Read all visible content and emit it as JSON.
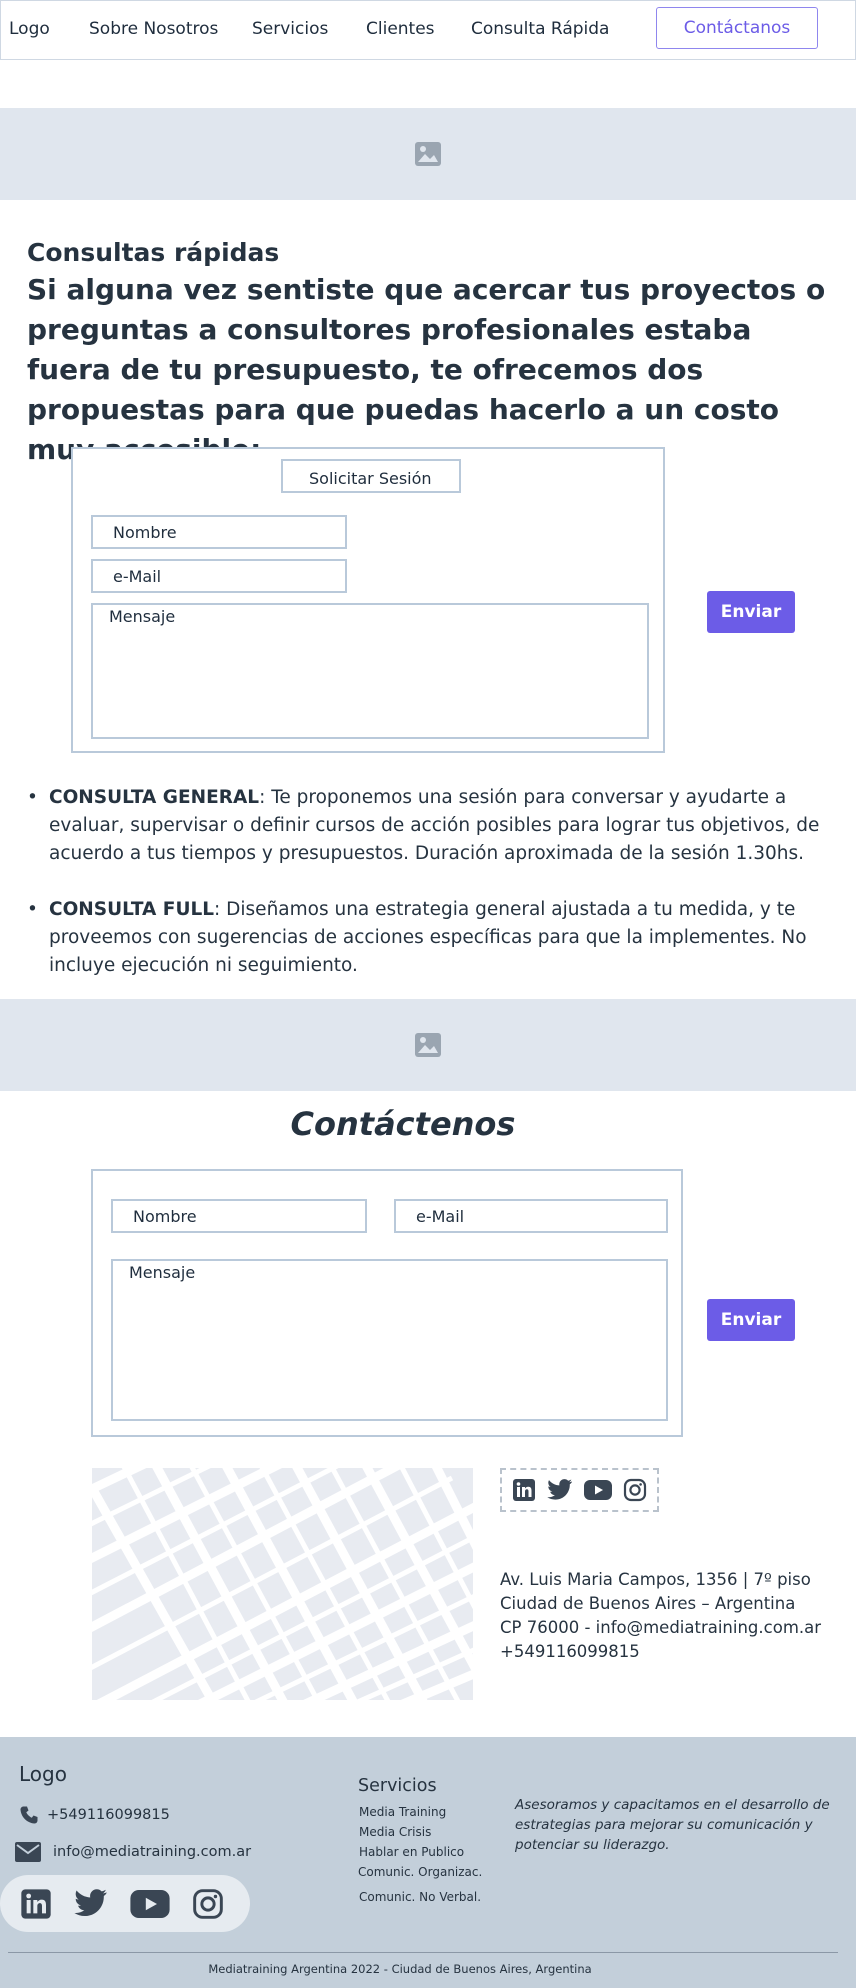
{
  "nav": {
    "logo": "Logo",
    "items": [
      "Sobre Nosotros",
      "Servicios",
      "Clientes",
      "Consulta Rápida"
    ],
    "cta": "Contáctanos"
  },
  "quick": {
    "title": "Consultas rápidas",
    "headline": "Si alguna vez sentiste que acercar tus proyectos o preguntas a consultores profesionales estaba fuera de tu presupuesto, te ofrecemos dos propuestas para que puedas hacerlo a un costo muy accesible:",
    "form": {
      "session_button": "Solicitar Sesión",
      "name": "Nombre",
      "email": "e-Mail",
      "message": "Mensaje",
      "send": "Enviar"
    },
    "offers": [
      {
        "name": "CONSULTA GENERAL",
        "text": ": Te proponemos una sesión para conversar y ayudarte a evaluar, supervisar o definir cursos de acción posibles para lograr tus objetivos, de acuerdo a tus tiempos y presupuestos. Duración aproximada de la sesión 1.30hs."
      },
      {
        "name": "CONSULTA FULL",
        "text": ": Diseñamos una estrategia general ajustada a tu medida, y te proveemos con sugerencias de acciones específicas para que la implementes. No incluye ejecución ni seguimiento."
      }
    ]
  },
  "contact": {
    "title": "Contáctenos",
    "form": {
      "name": "Nombre",
      "email": "e-Mail",
      "message": "Mensaje",
      "send": "Enviar"
    },
    "social": [
      "linkedin-icon",
      "twitter-icon",
      "youtube-icon",
      "instagram-icon"
    ],
    "address": [
      "Av. Luis Maria Campos, 1356 | 7º piso",
      "Ciudad de Buenos Aires – Argentina",
      "CP 76000 - info@mediatraining.com.ar",
      "+549116099815"
    ]
  },
  "footer": {
    "logo": "Logo",
    "phone": "+549116099815",
    "email": "info@mediatraining.com.ar",
    "services_title": "Servicios",
    "services": [
      "Media Training",
      "Media Crisis",
      "Hablar en Publico",
      "Comunic. Organizac.",
      "Comunic. No Verbal."
    ],
    "tagline": "Asesoramos y capacitamos en el desarrollo de estrategias para mejorar su comunicación y potenciar su liderazgo.",
    "copyright": "Mediatraining Argentina 2022 -  Ciudad de Buenos Aires, Argentina"
  },
  "colors": {
    "accent": "#6c5ce7",
    "placeholder_band": "#e0e6ee",
    "footer_bg": "#c3cfda",
    "text": "#263340"
  }
}
